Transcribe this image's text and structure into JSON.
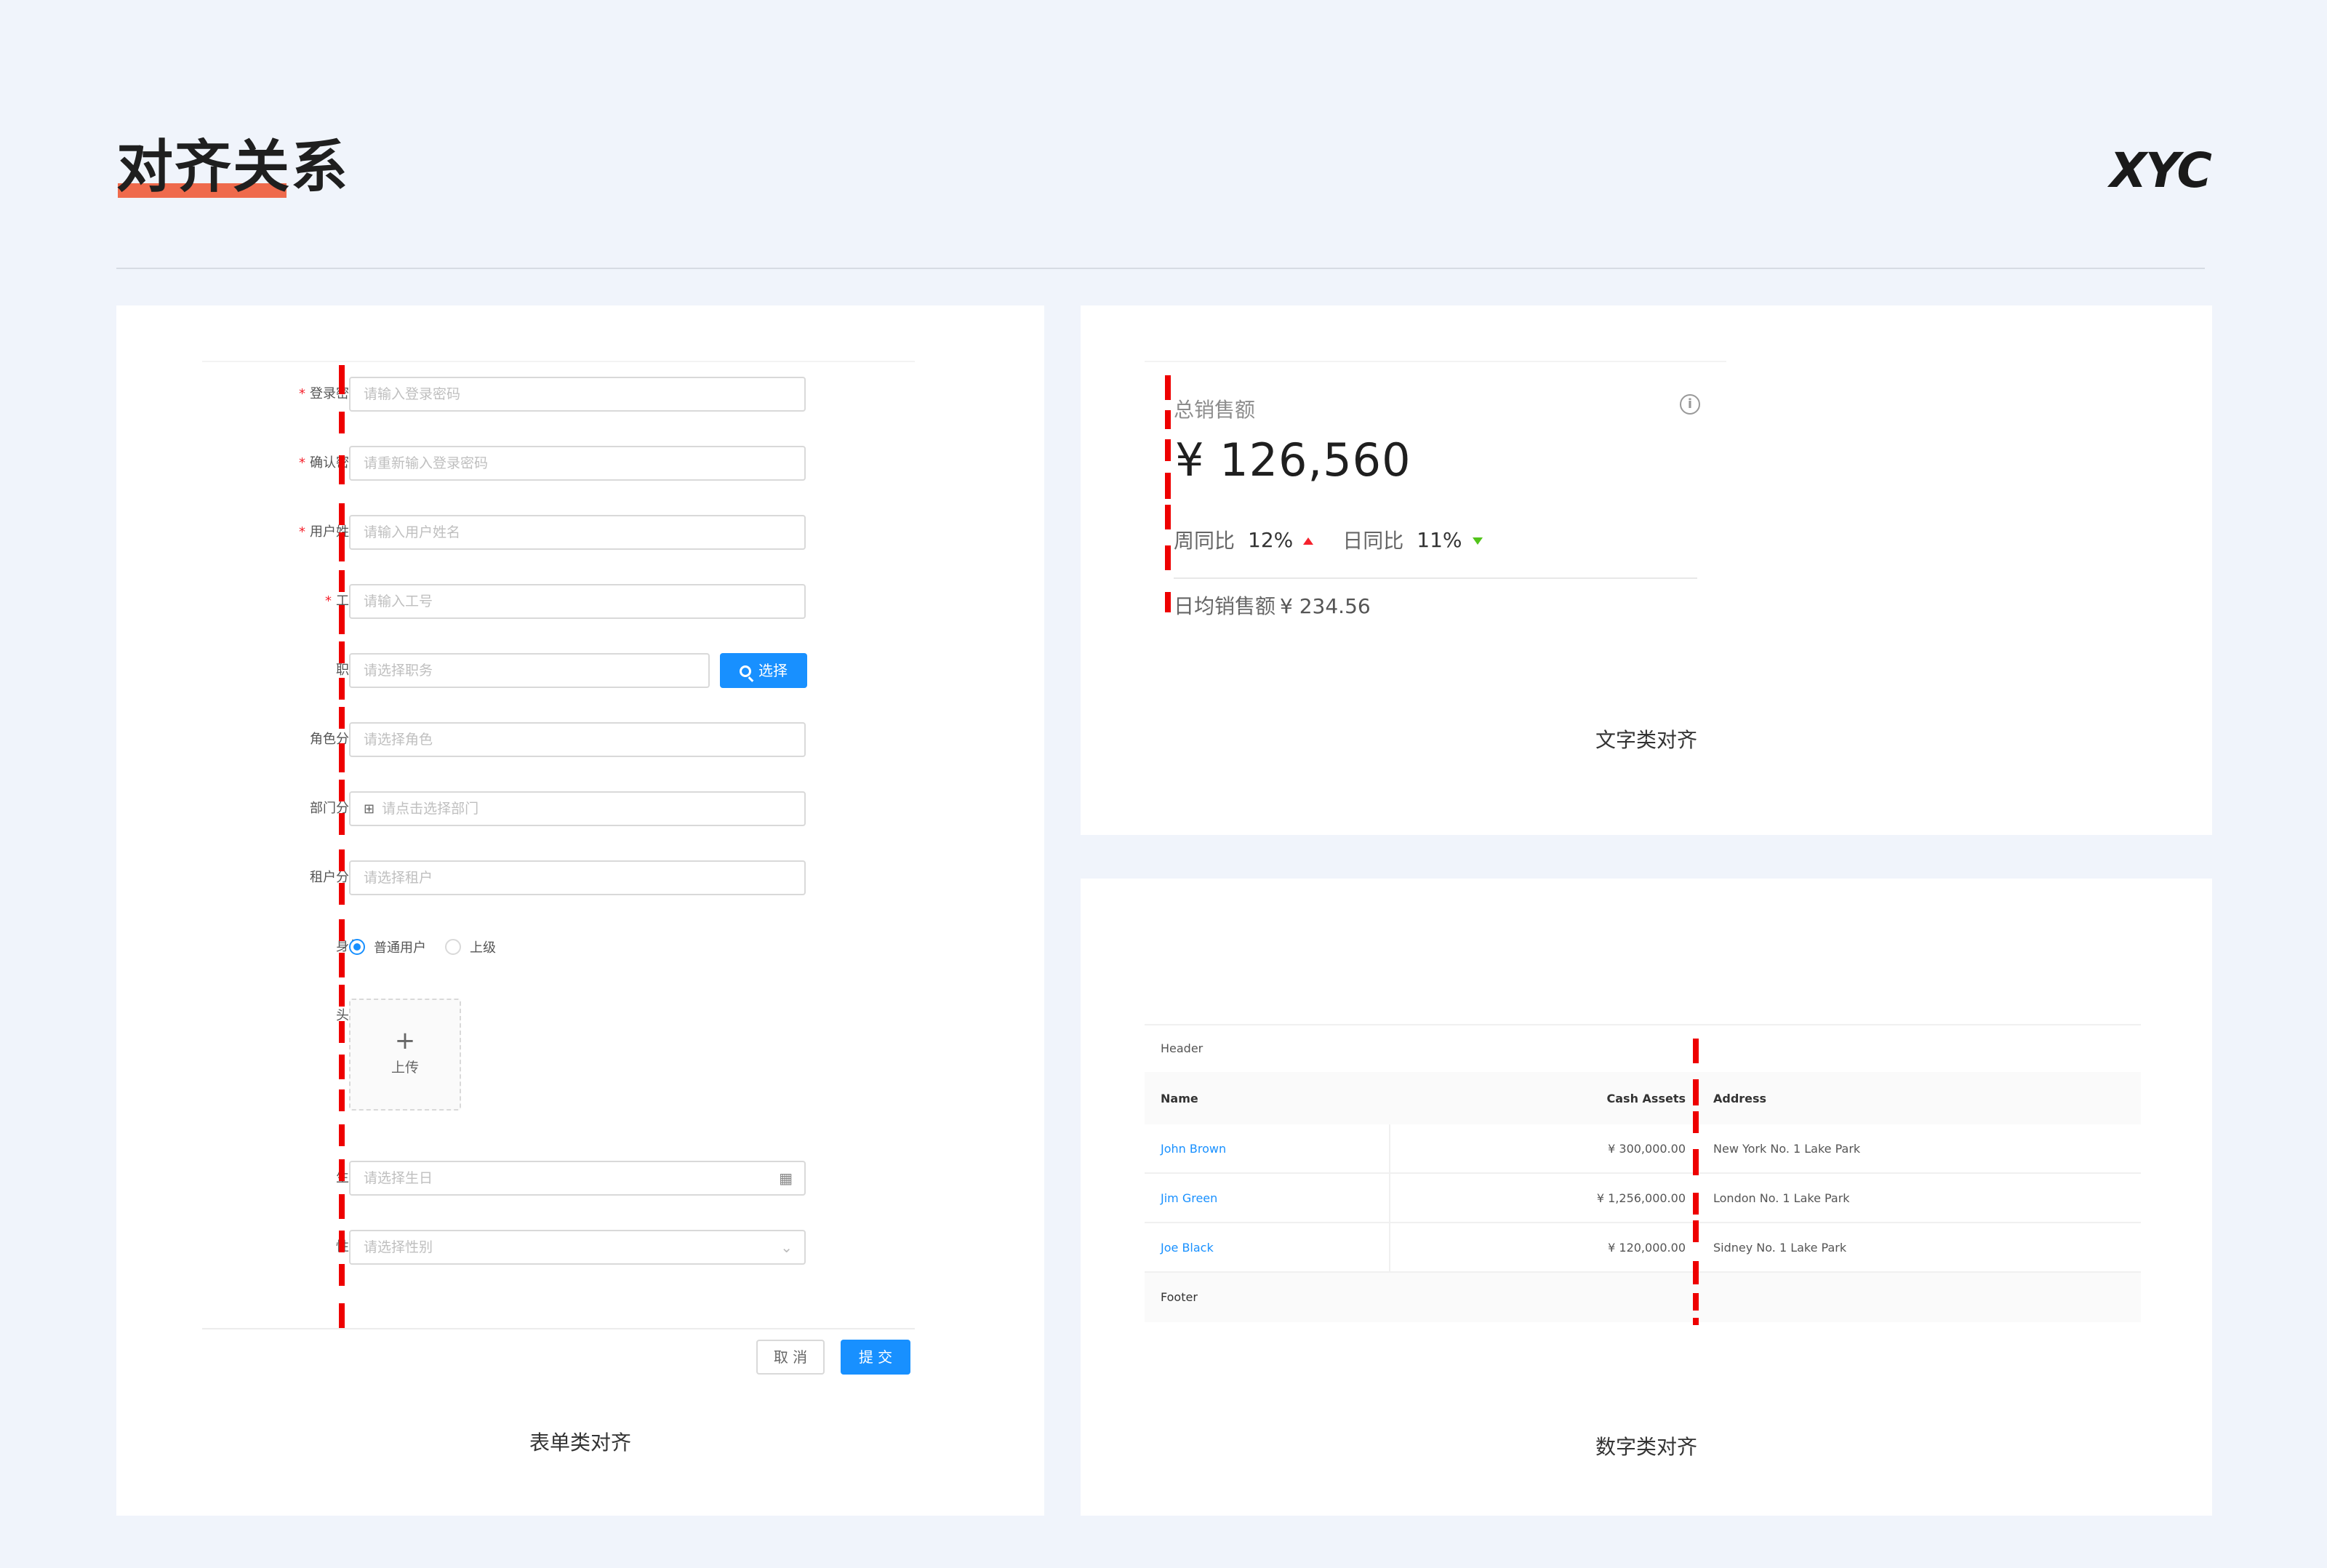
{
  "page": {
    "title": "对齐关系",
    "logo": "XYC"
  },
  "form_card": {
    "caption": "表单类对齐",
    "fields": [
      {
        "label": "登录密码",
        "required": true,
        "placeholder": "请输入登录密码"
      },
      {
        "label": "确认密码",
        "required": true,
        "placeholder": "请重新输入登录密码"
      },
      {
        "label": "用户姓名",
        "required": true,
        "placeholder": "请输入用户姓名"
      },
      {
        "label": "工号",
        "required": true,
        "placeholder": "请输入工号"
      },
      {
        "label": "职务",
        "required": false,
        "placeholder": "请选择职务",
        "button": "选择"
      },
      {
        "label": "角色分配",
        "required": false,
        "placeholder": "请选择角色"
      },
      {
        "label": "部门分配",
        "required": false,
        "placeholder": "请点击选择部门"
      },
      {
        "label": "租户分配",
        "required": false,
        "placeholder": "请选择租户"
      },
      {
        "label": "身份",
        "required": false,
        "options": [
          "普通用户",
          "上级"
        ],
        "selected": "普通用户"
      },
      {
        "label": "头像",
        "required": false,
        "upload_label": "上传"
      },
      {
        "label": "生日",
        "required": false,
        "placeholder": "请选择生日"
      },
      {
        "label": "性别",
        "required": false,
        "placeholder": "请选择性别"
      }
    ],
    "cancel_label": "取 消",
    "submit_label": "提 交",
    "required_mark": "*",
    "icons": {
      "search": "search-icon",
      "department": "org-tree-icon",
      "calendar": "calendar-icon",
      "select": "chevron-down-icon",
      "upload": "plus-icon"
    }
  },
  "text_card": {
    "caption": "文字类对齐",
    "label": "总销售额",
    "value": "¥ 126,560",
    "week_label": "周同比",
    "week_value": "12%",
    "day_label": "日同比",
    "day_value": "11%",
    "avg_label": "日均销售额",
    "avg_value": "¥ 234.56",
    "colors": {
      "up": "#f5222d",
      "down": "#52c41a"
    }
  },
  "table_card": {
    "caption": "数字类对齐",
    "header": "Header",
    "columns": [
      "Name",
      "Cash Assets",
      "Address"
    ],
    "rows": [
      {
        "name": "John Brown",
        "cash": "¥ 300,000.00",
        "address": "New York No. 1 Lake Park"
      },
      {
        "name": "Jim Green",
        "cash": "¥ 1,256,000.00",
        "address": "London No. 1 Lake Park"
      },
      {
        "name": "Joe Black",
        "cash": "¥ 120,000.00",
        "address": "Sidney No. 1 Lake Park"
      }
    ],
    "footer": "Footer"
  },
  "colors": {
    "background": "#f0f4fb",
    "guide_line": "#ee0000",
    "primary": "#1890ff",
    "title_underline": "#ef6a4c"
  }
}
